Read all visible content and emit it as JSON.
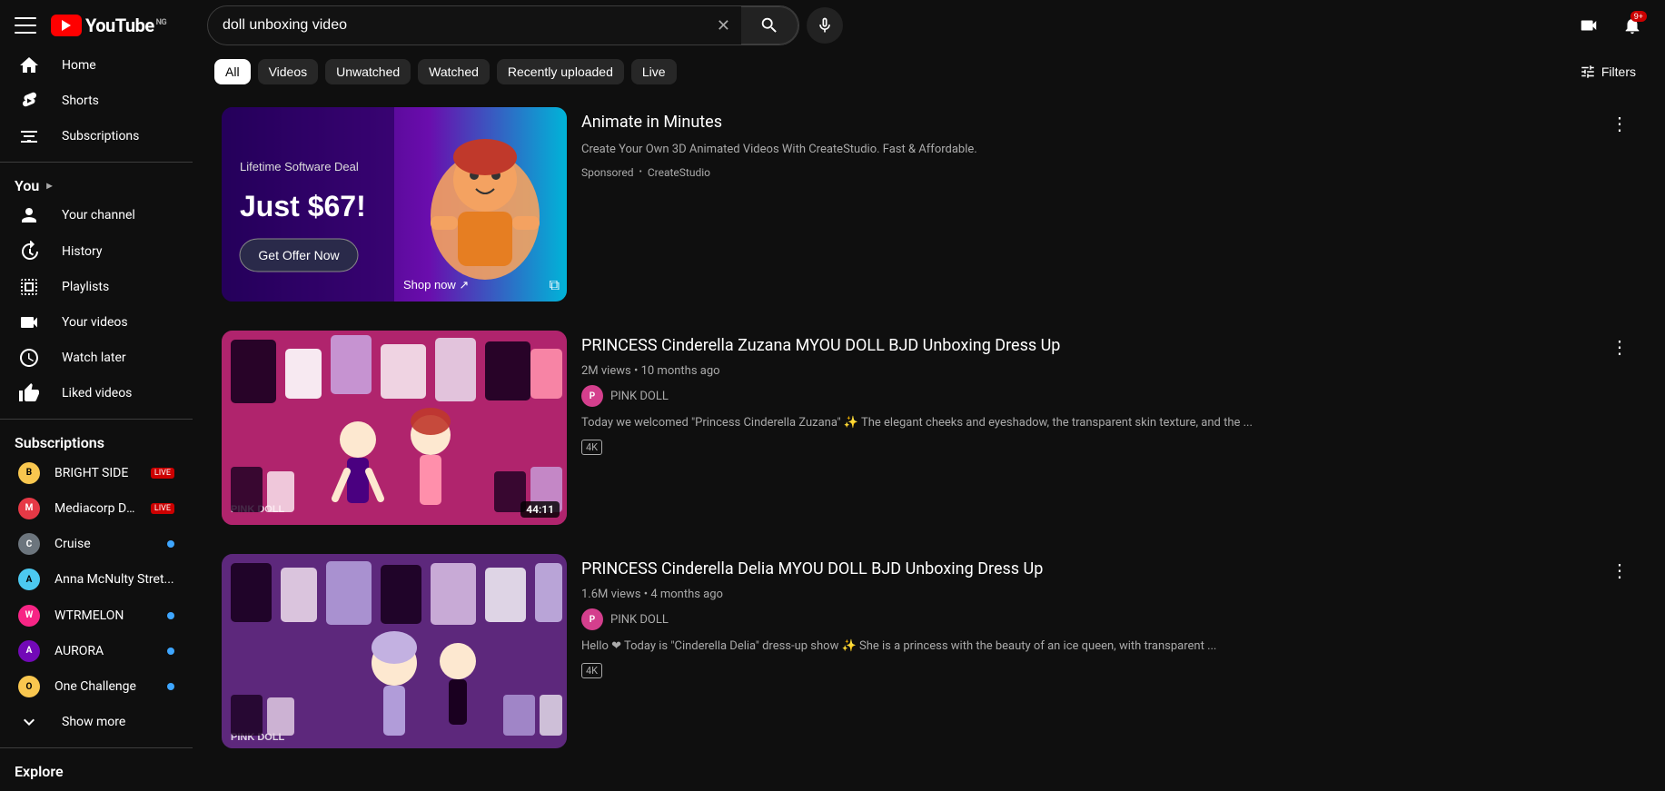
{
  "sidebar": {
    "logo": "YouTube",
    "ng_badge": "NG",
    "nav_items": [
      {
        "id": "home",
        "label": "Home",
        "icon": "home"
      },
      {
        "id": "shorts",
        "label": "Shorts",
        "icon": "shorts"
      },
      {
        "id": "subscriptions",
        "label": "Subscriptions",
        "icon": "subscriptions"
      }
    ],
    "you_section": "You",
    "you_items": [
      {
        "id": "your-channel",
        "label": "Your channel",
        "icon": "person"
      },
      {
        "id": "history",
        "label": "History",
        "icon": "history"
      },
      {
        "id": "playlists",
        "label": "Playlists",
        "icon": "playlist"
      },
      {
        "id": "your-videos",
        "label": "Your videos",
        "icon": "video"
      },
      {
        "id": "watch-later",
        "label": "Watch later",
        "icon": "clock"
      },
      {
        "id": "liked-videos",
        "label": "Liked videos",
        "icon": "thumb-up"
      }
    ],
    "subscriptions_section": "Subscriptions",
    "subscriptions": [
      {
        "id": "bright-side",
        "label": "BRIGHT SIDE",
        "color": "#f9c74f",
        "live": true,
        "dot": false
      },
      {
        "id": "mediacorp",
        "label": "Mediacorp Drama",
        "color": "#e63946",
        "live": true,
        "dot": false
      },
      {
        "id": "cruise",
        "label": "Cruise",
        "color": "#6c757d",
        "dot": true,
        "live": false
      },
      {
        "id": "anna",
        "label": "Anna McNulty Stret...",
        "color": "#4cc9f0",
        "dot": false,
        "live": false
      },
      {
        "id": "wtrmelon",
        "label": "WTRMELON",
        "color": "#f72585",
        "dot": true,
        "live": false
      },
      {
        "id": "aurora",
        "label": "AURORA",
        "color": "#7209b7",
        "dot": true,
        "live": false
      },
      {
        "id": "one-challenge",
        "label": "One Challenge",
        "color": "#f9c74f",
        "dot": true,
        "live": false
      }
    ],
    "show_more": "Show more",
    "explore_section": "Explore"
  },
  "topbar": {
    "search_value": "doll unboxing video",
    "search_placeholder": "Search",
    "notification_count": "9+",
    "mic_label": "Search with your voice"
  },
  "filters": {
    "chips": [
      {
        "id": "all",
        "label": "All",
        "active": true
      },
      {
        "id": "videos",
        "label": "Videos",
        "active": false
      },
      {
        "id": "unwatched",
        "label": "Unwatched",
        "active": false
      },
      {
        "id": "watched",
        "label": "Watched",
        "active": false
      },
      {
        "id": "recently-uploaded",
        "label": "Recently uploaded",
        "active": false
      },
      {
        "id": "live",
        "label": "Live",
        "active": false
      }
    ],
    "filters_label": "Filters"
  },
  "videos": [
    {
      "id": "ad1",
      "title": "Animate in Minutes",
      "is_ad": true,
      "sponsored_label": "Sponsored",
      "channel": "CreateStudio",
      "description": "Create Your Own 3D Animated Videos With CreateStudio. Fast & Affordable.",
      "thumbnail_type": "ad",
      "ad_text1": "Lifetime Software Deal",
      "ad_text2": "Just $67!",
      "ad_cta": "Get Offer Now",
      "ad_shop": "Shop now",
      "has_external_link": true
    },
    {
      "id": "video1",
      "title": "PRINCESS Cinderella Zuzana MYOU DOLL BJD Unboxing Dress Up",
      "views": "2M views",
      "age": "10 months ago",
      "channel": "PINK DOLL",
      "description": "Today we welcomed \"Princess Cinderella Zuzana\" ✨ The elegant cheeks and eyeshadow, the transparent skin texture, and the ...",
      "duration": "44:11",
      "quality": "4K",
      "thumbnail_type": "pink-doll1",
      "channel_color": "#d43f8d"
    },
    {
      "id": "video2",
      "title": "PRINCESS Cinderella Delia MYOU DOLL BJD Unboxing Dress Up",
      "views": "1.6M views",
      "age": "4 months ago",
      "channel": "PINK DOLL",
      "description": "Hello ❤ Today is \"Cinderella Delia\" dress-up show ✨ She is a princess with the beauty of an ice queen, with transparent ...",
      "quality": "4K",
      "thumbnail_type": "pink-doll2",
      "channel_color": "#d43f8d"
    }
  ]
}
